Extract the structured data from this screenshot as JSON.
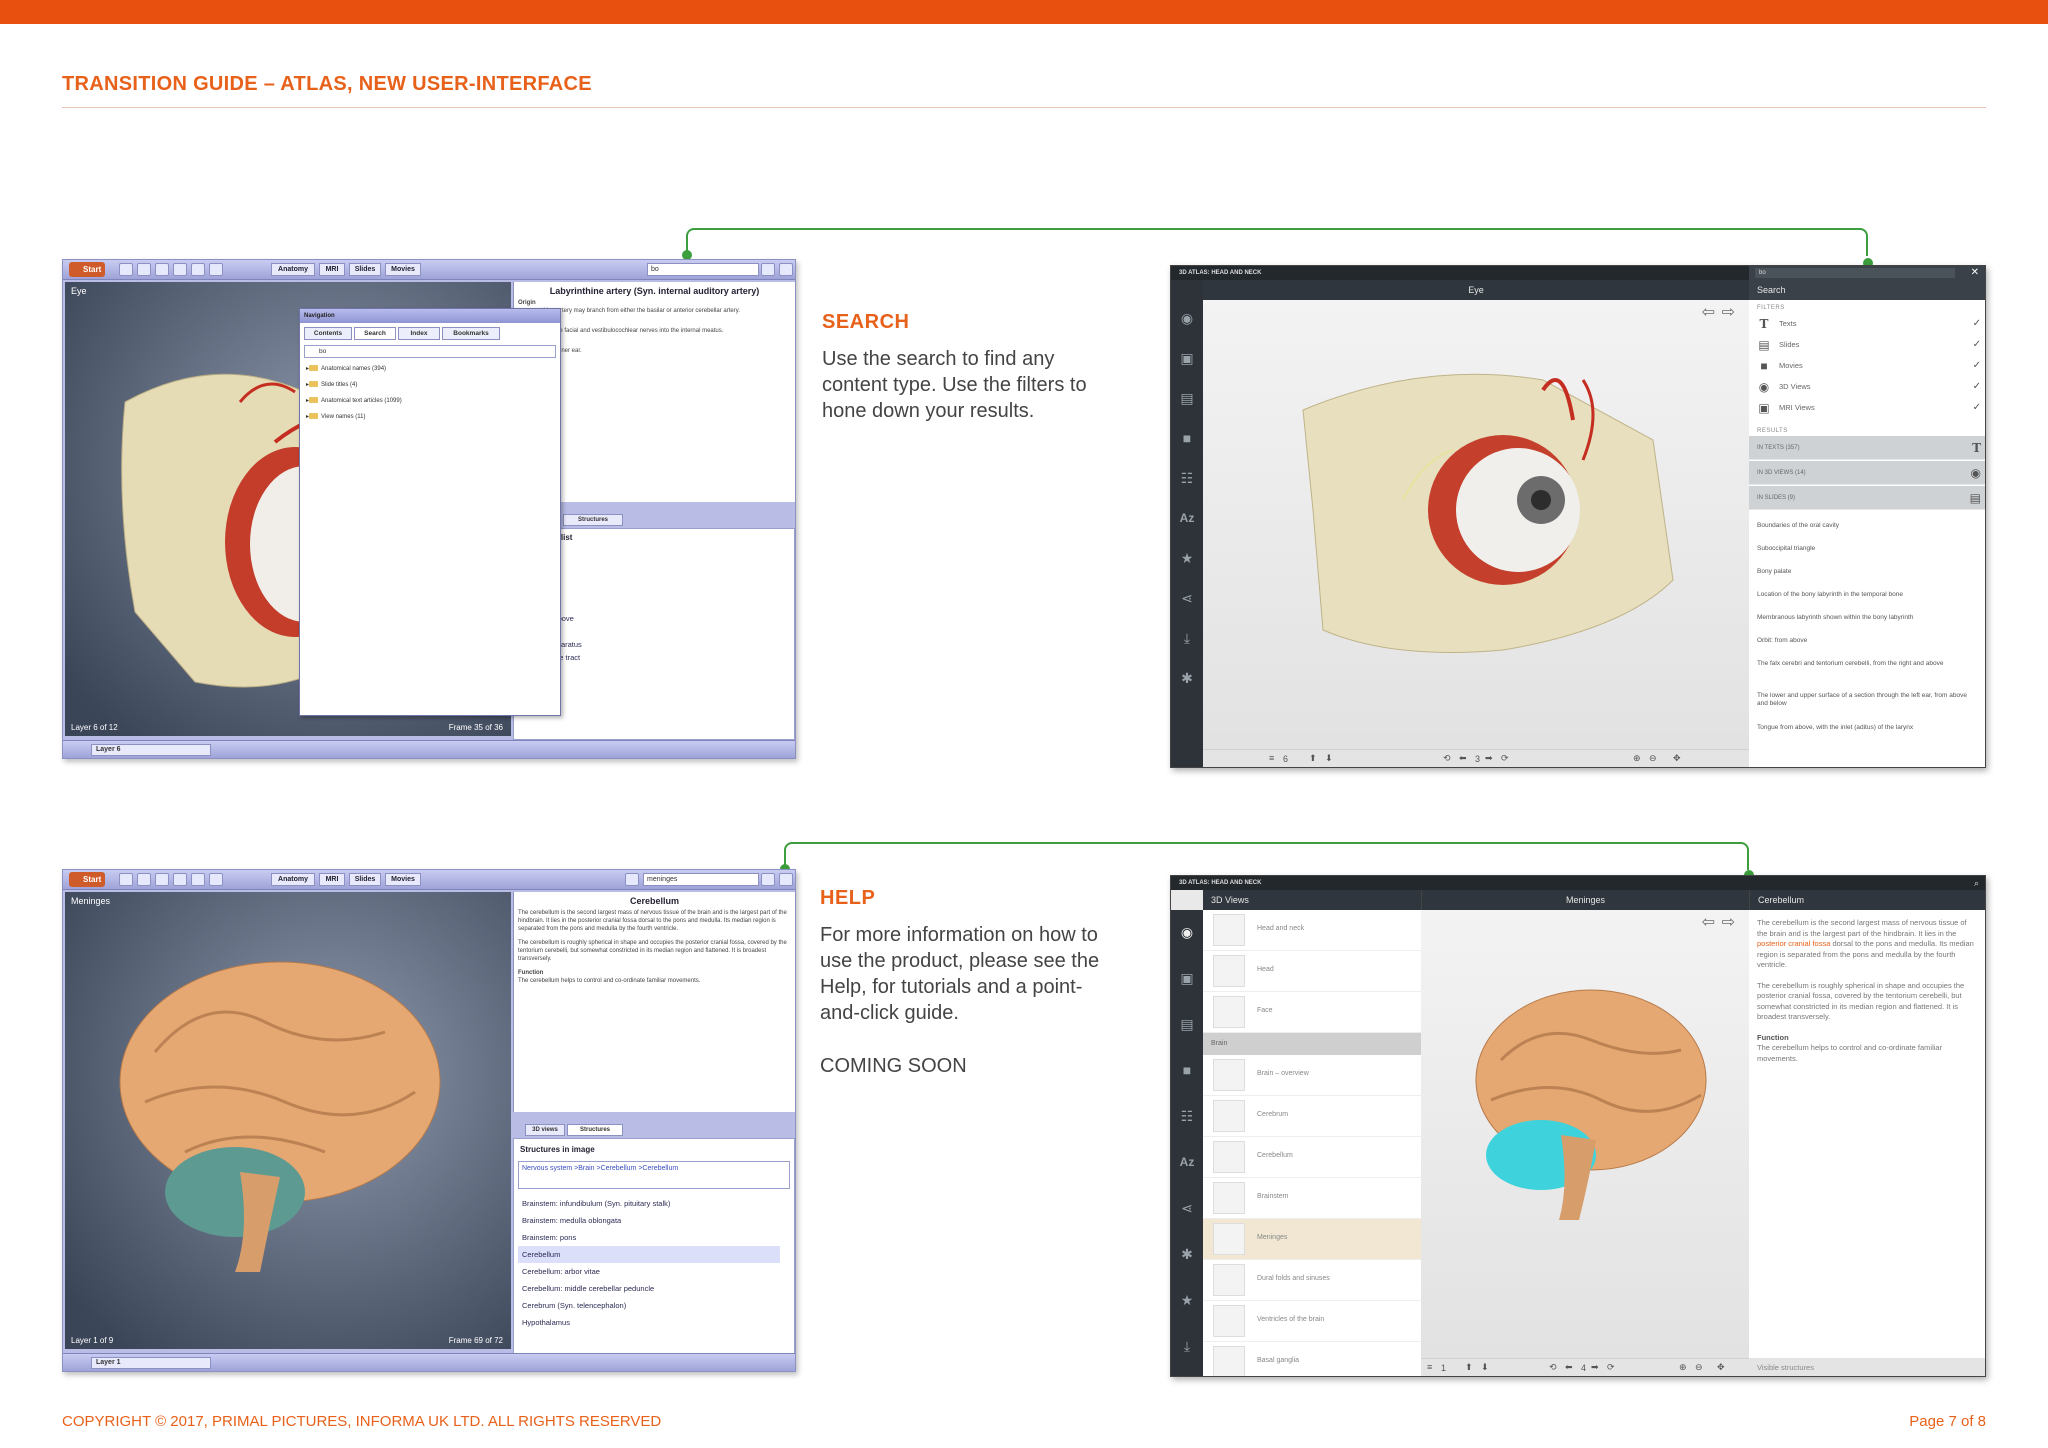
{
  "doc": {
    "title": "TRANSITION GUIDE – ATLAS, NEW USER-INTERFACE",
    "footer_copyright": "COPYRIGHT © 2017, PRIMAL PICTURES, INFORMA UK LTD. ALL RIGHTS RESERVED",
    "footer_page": "Page 7 of  8"
  },
  "search_section": {
    "heading": "SEARCH",
    "body": "Use the search to find any content type. Use the filters to hone down your results."
  },
  "help_section": {
    "heading": "HELP",
    "body": "For more information on how to use the product, please see the Help, for tutorials and a point-and-click guide.",
    "coming_soon": "COMING SOON"
  },
  "old_ui_search": {
    "start": "Start",
    "tabs": [
      "Anatomy",
      "MRI",
      "Slides",
      "Movies"
    ],
    "search_value": "bo",
    "viewport_title": "Eye",
    "layer_label": "Layer 6 of 12",
    "frame_label": "Frame 35 of 36",
    "layer_select": "Layer 6",
    "panel_title": "Labyrinthine artery (Syn. internal auditory artery)",
    "panel_origin": "Origin",
    "panel_text_1": "thine artery may branch from either the basilar or anterior cerebellar artery.",
    "panel_text_2": "with the facial and vestibulocochlear nerves into the internal meatus.",
    "panel_text_3": "s the inner ear.",
    "structures_tab": "Structures",
    "list_title": "tomy view list",
    "list_items": [
      "ad and neck",
      "ad",
      "ce",
      "ain",
      "e",
      "Orbit from above",
      "Eye",
      "Lacrimal apparatus",
      "",
      "Aerodigestive tract"
    ],
    "nav": {
      "title": "Navigation",
      "tabs": [
        "Contents",
        "Search",
        "Index",
        "Bookmarks"
      ],
      "input": "bo",
      "items": [
        "Anatomical names (394)",
        "Slide titles (4)",
        "Anatomical text articles (1099)",
        "View names (11)"
      ]
    }
  },
  "new_ui_search": {
    "titlebar": "3D ATLAS: HEAD AND NECK",
    "header_center": "Eye",
    "search_value": "bo",
    "panel_title": "Search",
    "filters_label": "FILTERS",
    "filters": [
      {
        "label": "Texts",
        "icon": "text-icon"
      },
      {
        "label": "Slides",
        "icon": "slides-icon"
      },
      {
        "label": "Movies",
        "icon": "movies-icon"
      },
      {
        "label": "3D Views",
        "icon": "3d-views-icon"
      },
      {
        "label": "MRI Views",
        "icon": "mri-views-icon"
      }
    ],
    "results_label": "RESULTS",
    "results": [
      "IN TEXTS (357)",
      "IN 3D VIEWS (14)",
      "IN SLIDES (9)"
    ],
    "links": [
      "Boundaries of the oral cavity",
      "Suboccipital triangle",
      "Bony palate",
      "Location of the bony labyrinth in the temporal bone",
      "Membranous labyrinth shown within the bony labyrinth",
      "Orbit: from above",
      "The falx cerebri and tentorium cerebelli, from the right and above",
      "The lower and upper surface of a section through the left ear, from above and below",
      "Tongue from above, with the inlet (aditus) of the larynx"
    ],
    "layer_count": "6",
    "frame_count": "3"
  },
  "old_ui_help": {
    "start": "Start",
    "tabs": [
      "Anatomy",
      "MRI",
      "Slides",
      "Movies"
    ],
    "search_value": "meninges",
    "viewport_title": "Meninges",
    "layer_label": "Layer 1 of 9",
    "frame_label": "Frame 69 of 72",
    "layer_select": "Layer 1",
    "panel_title": "Cerebellum",
    "panel_text_1": "The cerebellum is the second largest mass of nervous tissue of the brain and is the largest part of the hindbrain. It lies in the posterior cranial fossa dorsal to the pons and medulla. Its median region is separated from the pons and medulla by the fourth ventricle.",
    "panel_text_2": "The cerebellum is roughly spherical in shape and occupies the posterior cranial fossa, covered by the tentorium cerebelli, but somewhat constricted in its median region and flattened. It is broadest transversely.",
    "panel_function": "Function",
    "panel_text_3": "The cerebellum helps to control and co-ordinate familiar movements.",
    "views_tab": "3D views",
    "structures_tab": "Structures",
    "struct_title": "Structures in image",
    "breadcrumb": "Nervous system >Brain >Cerebellum >Cerebellum",
    "list_items": [
      "Brainstem: infundibulum (Syn. pituitary stalk)",
      "Brainstem: medulla oblongata",
      "Brainstem: pons",
      "Cerebellum",
      "Cerebellum: arbor vitae",
      "Cerebellum: middle cerebellar peduncle",
      "Cerebrum (Syn. telencephalon)",
      "Hypothalamus"
    ]
  },
  "new_ui_help": {
    "titlebar": "3D ATLAS: HEAD AND NECK",
    "header_left": "3D Views",
    "header_center": "Meninges",
    "header_right": "Cerebellum",
    "views": [
      "Head and neck",
      "Head",
      "Face"
    ],
    "group_header": "Brain",
    "brain_views": [
      "Brain – overview",
      "Cerebrum",
      "Cerebellum",
      "Brainstem",
      "Meninges",
      "Dural folds and sinuses",
      "Ventricles of the brain",
      "Basal ganglia"
    ],
    "text_1a": "The cerebellum is the second largest mass of nervous tissue of the brain and is the largest part of the hindbrain. It lies in the ",
    "text_1_link": "posterior cranial fossa",
    "text_1b": " dorsal to the pons and medulla. Its median region is separated from the pons and medulla by the fourth ventricle.",
    "text_2": "The cerebellum is roughly spherical in shape and occupies the posterior cranial fossa, covered by the tentorium cerebelli, but somewhat constricted in its median region and flattened. It is broadest transversely.",
    "function_label": "Function",
    "text_3": "The cerebellum helps to control and co-ordinate familiar movements.",
    "visible_structures": "Visible structures",
    "layer_count": "1",
    "frame_count": "4"
  },
  "colors": {
    "brand_orange": "#e8500f",
    "connector_green": "#3c9e3c"
  }
}
